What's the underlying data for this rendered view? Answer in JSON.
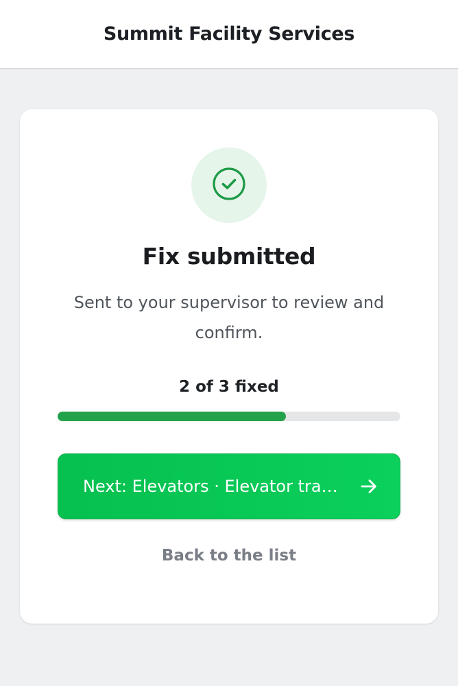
{
  "header": {
    "title": "Summit Facility Services"
  },
  "status": {
    "icon": "check-circle-icon",
    "headline": "Fix submitted",
    "message": "Sent to your supervisor to review and confirm."
  },
  "progress": {
    "label": "2 of 3 fixed",
    "fixed": 2,
    "total": 3
  },
  "actions": {
    "next_label": "Next: Elevators · Elevator trapped passenger alarm",
    "next_icon": "arrow-right-icon",
    "back_label": "Back to the list"
  },
  "colors": {
    "accent_green": "#0bc855",
    "success_green": "#22a24a",
    "success_bg": "#e6f5ea"
  }
}
